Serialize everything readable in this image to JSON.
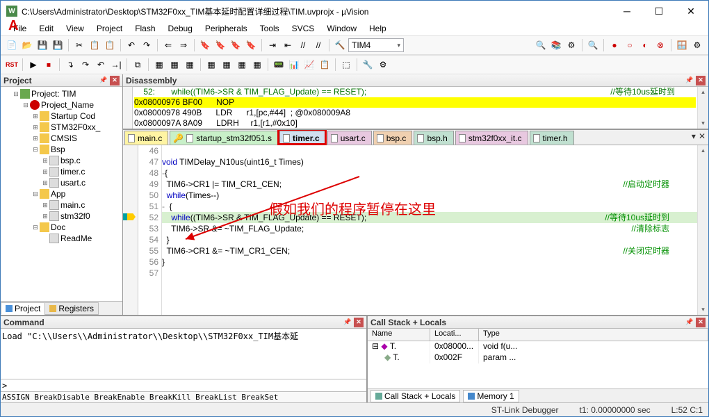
{
  "window": {
    "title": "C:\\Users\\Administrator\\Desktop\\STM32F0xx_TIM基本延时配置详细过程\\TIM.uvprojx - µVision",
    "app_icon_label": "W"
  },
  "menu": [
    "File",
    "Edit",
    "View",
    "Project",
    "Flash",
    "Debug",
    "Peripherals",
    "Tools",
    "SVCS",
    "Window",
    "Help"
  ],
  "toolbar_combo": "TIM4",
  "annotations": {
    "red_A": "A",
    "red_text": "假如我们的程序暂停在这里"
  },
  "project": {
    "title": "Project",
    "root": "Project: TIM",
    "target": "Project_Name",
    "folders": [
      {
        "name": "Startup Cod",
        "files": []
      },
      {
        "name": "STM32F0xx_",
        "files": []
      },
      {
        "name": "CMSIS",
        "files": []
      },
      {
        "name": "Bsp",
        "open": true,
        "files": [
          "bsp.c",
          "timer.c",
          "usart.c"
        ]
      },
      {
        "name": "App",
        "open": true,
        "files": [
          "main.c",
          "stm32f0"
        ]
      },
      {
        "name": "Doc",
        "open": true,
        "files": [
          "ReadMe"
        ]
      }
    ],
    "tabs": [
      {
        "label": "Project",
        "icon": "blue",
        "active": true
      },
      {
        "label": "Registers",
        "icon": "yellow",
        "active": false
      }
    ]
  },
  "disassembly": {
    "title": "Disassembly",
    "lines": [
      {
        "text": "    52:       while((TIM6->SR & TIM_FLAG_Update) == RESET);",
        "cmt": "//等待10us延时到",
        "cls": "line-cmt"
      },
      {
        "text": "0x08000976 BF00      NOP      ",
        "cmt": "",
        "cls": "line-yellow"
      },
      {
        "text": "0x08000978 490B      LDR      r1,[pc,#44]  ; @0x080009A8",
        "cmt": "",
        "cls": ""
      },
      {
        "text": "0x0800097A 8A09      LDRH     r1,[r1,#0x10]",
        "cmt": "",
        "cls": ""
      }
    ]
  },
  "file_tabs": [
    {
      "label": "main.c",
      "cls": "col-yellow"
    },
    {
      "label": "startup_stm32f051.s",
      "cls": "col-green",
      "lock": true
    },
    {
      "label": "timer.c",
      "cls": "col-blue",
      "active": true
    },
    {
      "label": "usart.c",
      "cls": "col-pink"
    },
    {
      "label": "bsp.c",
      "cls": "col-orange"
    },
    {
      "label": "bsp.h",
      "cls": "col-teal"
    },
    {
      "label": "stm32f0xx_it.c",
      "cls": "col-pink"
    },
    {
      "label": "timer.h",
      "cls": "col-teal"
    }
  ],
  "code": {
    "lines": [
      {
        "n": 46,
        "txt": ""
      },
      {
        "n": 47,
        "txt": "void TIMDelay_N10us(uint16_t Times)",
        "kw": [
          "void"
        ]
      },
      {
        "n": 48,
        "txt": "{",
        "fold": "-"
      },
      {
        "n": 49,
        "txt": "  TIM6->CR1 |= TIM_CR1_CEN;",
        "cmt": "//启动定时器"
      },
      {
        "n": 50,
        "txt": "  while(Times--)",
        "kw": [
          "while"
        ]
      },
      {
        "n": 51,
        "txt": "  {",
        "fold": "-"
      },
      {
        "n": 52,
        "txt": "    while((TIM6->SR & TIM_FLAG_Update) == RESET);",
        "cmt": "//等待10us延时到",
        "kw": [
          "while"
        ],
        "hl": true,
        "bp": true
      },
      {
        "n": 53,
        "txt": "    TIM6->SR &= ~TIM_FLAG_Update;",
        "cmt": "//清除标志"
      },
      {
        "n": 54,
        "txt": "  }"
      },
      {
        "n": 55,
        "txt": "  TIM6->CR1 &= ~TIM_CR1_CEN;",
        "cmt": "//关闭定时器"
      },
      {
        "n": 56,
        "txt": "}"
      },
      {
        "n": 57,
        "txt": ""
      }
    ]
  },
  "command": {
    "title": "Command",
    "body": "Load \"C:\\\\Users\\\\Administrator\\\\Desktop\\\\STM32F0xx_TIM基本延",
    "prompt": ">",
    "assign": "ASSIGN BreakDisable BreakEnable BreakKill BreakList BreakSet"
  },
  "callstack": {
    "title": "Call Stack + Locals",
    "cols": [
      "Name",
      "Locati...",
      "Type"
    ],
    "rows": [
      {
        "exp": "-",
        "ico": "T.",
        "name": "T.",
        "loc": "0x08000...",
        "type": "void f(u..."
      },
      {
        "exp": "",
        "ico": "T.",
        "name": "T.",
        "loc": "0x002F",
        "type": "param ..."
      }
    ],
    "tabs": [
      {
        "label": "Call Stack + Locals",
        "active": true
      },
      {
        "label": "Memory 1",
        "active": false
      }
    ]
  },
  "status": {
    "debugger": "ST-Link Debugger",
    "time": "t1: 0.00000000 sec",
    "pos": "L:52 C:1"
  }
}
